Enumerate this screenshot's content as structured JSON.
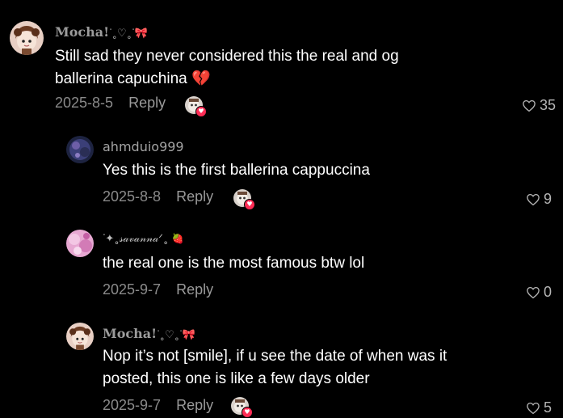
{
  "comments": [
    {
      "username": "Mocha!",
      "username_deco": "ᐝ˳♡˳ᐝ",
      "username_bow": "🎀",
      "text_line1": "Still sad they never considered this the real and og",
      "text_line2": "ballerina capuchina 💔",
      "date": "2025-8-5",
      "reply_label": "Reply",
      "likes": "35"
    },
    {
      "username": "ahmduio999",
      "text_line1": "Yes this is the first ballerina cappuccina",
      "date": "2025-8-8",
      "reply_label": "Reply",
      "likes": "9"
    },
    {
      "username": "ᐝ✦˳𝓈𝒶𝓋𝒶𝓃𝓃𝒶ᐟ˳",
      "username_berry": "🍓",
      "text_line1": "the real one is the most famous btw lol",
      "date": "2025-9-7",
      "reply_label": "Reply",
      "likes": "0"
    },
    {
      "username": "Mocha!",
      "username_deco": "ᐝ˳♡˳ᐝ",
      "username_bow": "🎀",
      "text_line1": "Nop it’s not [smile], if u see the date of when was it",
      "text_line2": "posted, this one is like a few days older",
      "date": "2025-9-7",
      "reply_label": "Reply",
      "likes": "5"
    }
  ],
  "colors": {
    "background": "#000000",
    "primary_text": "#ffffff",
    "secondary_text": "#8a8a8a",
    "like_badge": "#fe2c55"
  },
  "icons": {
    "like": "heart-outline-icon",
    "liked_by_creator_badge": "heart-badge-icon"
  }
}
